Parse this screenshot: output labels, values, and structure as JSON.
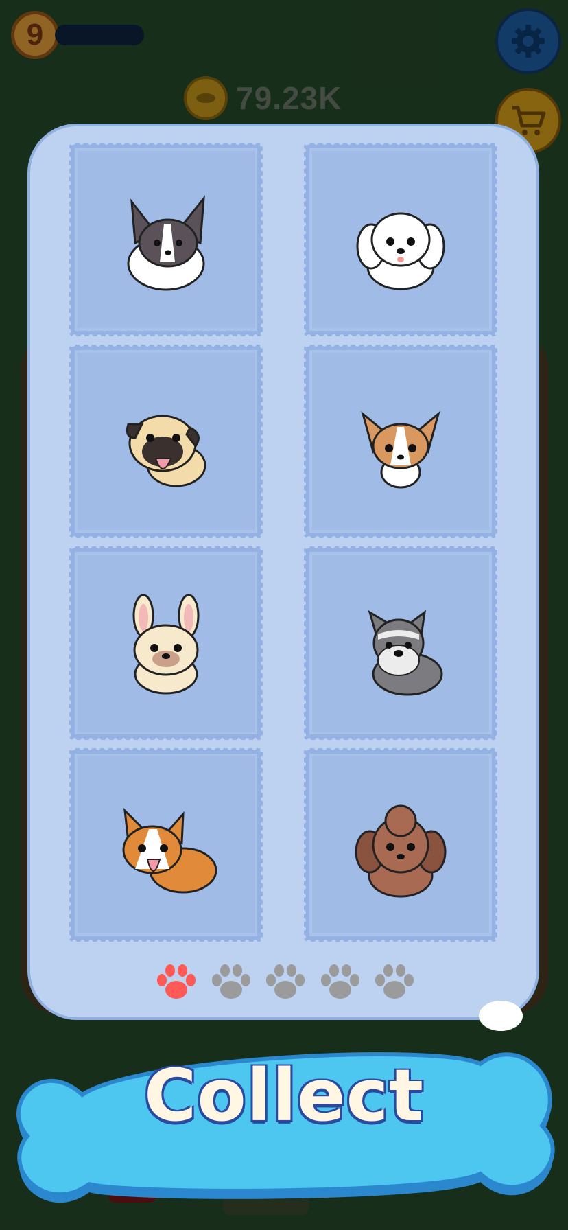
{
  "hud": {
    "level": "9",
    "coins": "79.23K",
    "icons": {
      "settings": "gear-icon",
      "shop": "cart-icon",
      "coin": "coin-icon"
    }
  },
  "collection": {
    "dogs": [
      {
        "breed": "papillon",
        "fur": "#5a5258",
        "accent": "#ffffff"
      },
      {
        "breed": "maltese",
        "fur": "#ffffff",
        "accent": "#ffffff"
      },
      {
        "breed": "pug",
        "fur": "#f3dcaa",
        "accent": "#3a302e"
      },
      {
        "breed": "chihuahua",
        "fur": "#d9985f",
        "accent": "#ffffff"
      },
      {
        "breed": "french-bulldog",
        "fur": "#f7e9cc",
        "accent": "#f3b8b8"
      },
      {
        "breed": "schnauzer",
        "fur": "#7c7c80",
        "accent": "#ececec"
      },
      {
        "breed": "corgi",
        "fur": "#e08a3a",
        "accent": "#ffffff"
      },
      {
        "breed": "poodle",
        "fur": "#a86a52",
        "accent": "#8a533f"
      }
    ],
    "pagination": {
      "total": 5,
      "active": 0,
      "active_color": "#ff5a55",
      "inactive_color": "#9b9b9b"
    }
  },
  "actions": {
    "collect_label": "Collect"
  },
  "colors": {
    "panel": "#bdd2f1",
    "stamp": "#9fbbe6",
    "bone": "#4dc7ef",
    "bone_edge": "#2b88cf"
  }
}
